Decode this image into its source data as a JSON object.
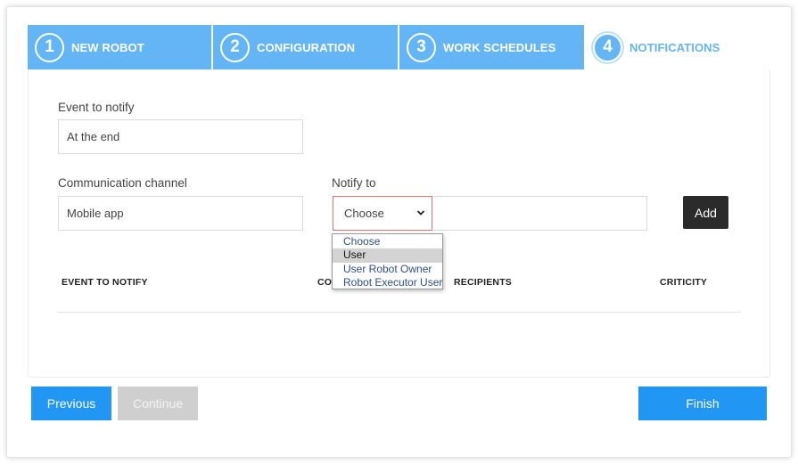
{
  "stepper": {
    "steps": [
      {
        "num": "1",
        "label": "NEW ROBOT"
      },
      {
        "num": "2",
        "label": "CONFIGURATION"
      },
      {
        "num": "3",
        "label": "WORK SCHEDULES"
      },
      {
        "num": "4",
        "label": "NOTIFICATIONS"
      }
    ]
  },
  "form": {
    "event_label": "Event to notify",
    "event_value": "At the end",
    "channel_label": "Communication channel",
    "channel_value": "Mobile app",
    "notify_label": "Notify to",
    "notify_selected": "Choose",
    "notify_options": [
      "Choose",
      "User",
      "User Robot Owner",
      "Robot Executor User"
    ],
    "highlighted_option": "User",
    "add_label": "Add"
  },
  "table": {
    "headers": [
      "EVENT TO NOTIFY",
      "CO",
      "RECIPIENTS",
      "CRITICITY"
    ]
  },
  "footer": {
    "previous_label": "Previous",
    "continue_label": "Continue",
    "finish_label": "Finish"
  },
  "colors": {
    "step_done": "#64b5f6",
    "primary": "#2196f3",
    "add_button": "#2b2b2b",
    "disabled": "#cfcfcf",
    "select_error_border": "#e57373"
  }
}
